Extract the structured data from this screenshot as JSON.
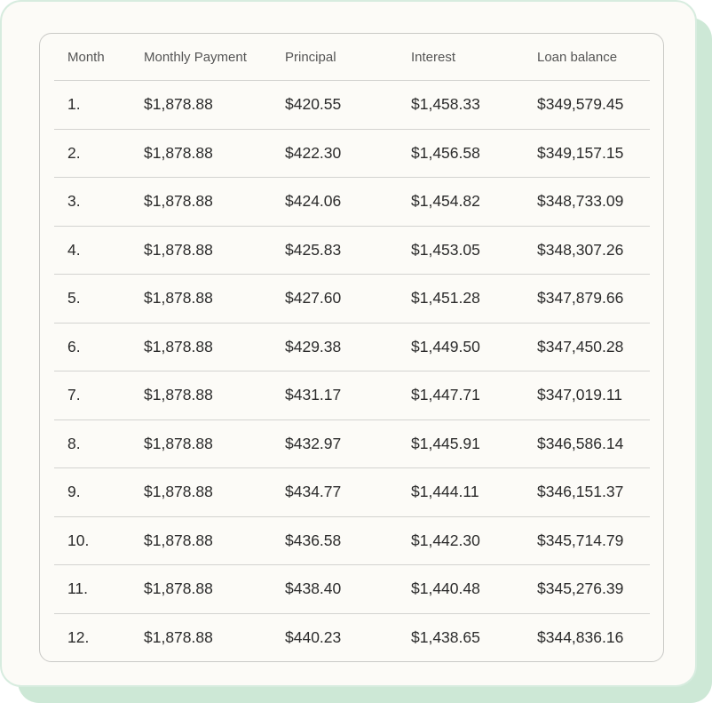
{
  "table": {
    "headers": [
      "Month",
      "Monthly Payment",
      "Principal",
      "Interest",
      "Loan balance"
    ],
    "rows": [
      [
        "1.",
        "$1,878.88",
        "$420.55",
        "$1,458.33",
        "$349,579.45"
      ],
      [
        "2.",
        "$1,878.88",
        "$422.30",
        "$1,456.58",
        "$349,157.15"
      ],
      [
        "3.",
        "$1,878.88",
        "$424.06",
        "$1,454.82",
        "$348,733.09"
      ],
      [
        "4.",
        "$1,878.88",
        "$425.83",
        "$1,453.05",
        "$348,307.26"
      ],
      [
        "5.",
        "$1,878.88",
        "$427.60",
        "$1,451.28",
        "$347,879.66"
      ],
      [
        "6.",
        "$1,878.88",
        "$429.38",
        "$1,449.50",
        "$347,450.28"
      ],
      [
        "7.",
        "$1,878.88",
        "$431.17",
        "$1,447.71",
        "$347,019.11"
      ],
      [
        "8.",
        "$1,878.88",
        "$432.97",
        "$1,445.91",
        "$346,586.14"
      ],
      [
        "9.",
        "$1,878.88",
        "$434.77",
        "$1,444.11",
        "$346,151.37"
      ],
      [
        "10.",
        "$1,878.88",
        "$436.58",
        "$1,442.30",
        "$345,714.79"
      ],
      [
        "11.",
        "$1,878.88",
        "$438.40",
        "$1,440.48",
        "$345,276.39"
      ],
      [
        "12.",
        "$1,878.88",
        "$440.23",
        "$1,438.65",
        "$344,836.16"
      ]
    ]
  },
  "colors": {
    "card_background": "#fcfbf7",
    "shadow_accent": "#cde8d6",
    "text": "#2b2b2b",
    "header_text": "#555555"
  }
}
